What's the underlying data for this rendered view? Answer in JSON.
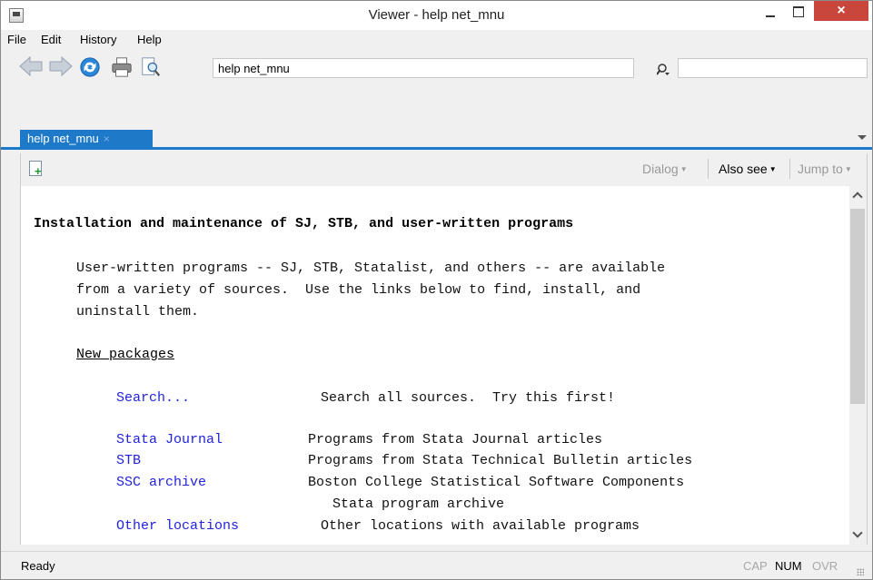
{
  "window": {
    "title": "Viewer - help net_mnu",
    "close_glyph": "×"
  },
  "menu": {
    "items": [
      "File",
      "Edit",
      "History",
      "Help"
    ]
  },
  "toolbar": {
    "address_value": "help net_mnu",
    "search_value": ""
  },
  "tabs": [
    {
      "label": "help net_mnu",
      "close_glyph": "×"
    }
  ],
  "helpbar": {
    "dialog": "Dialog",
    "also_see": "Also see",
    "jump_to": "Jump to"
  },
  "content": {
    "heading": "Installation and maintenance of SJ, STB, and user-written programs",
    "intro_lines": [
      "User-written programs -- SJ, STB, Statalist, and others -- are available",
      "from a variety of sources.  Use the links below to find, install, and",
      "uninstall them."
    ],
    "section_title": "New packages",
    "entries": [
      {
        "link": "Search...",
        "desc": "Search all sources.  Try this first!"
      },
      {
        "link": "Stata Journal",
        "desc": "Programs from Stata Journal articles"
      },
      {
        "link": "STB",
        "desc": "Programs from Stata Technical Bulletin articles"
      },
      {
        "link": "SSC archive",
        "desc": "Boston College Statistical Software Components"
      },
      {
        "link": "",
        "desc": "   Stata program archive"
      },
      {
        "link": "Other locations",
        "desc": "Other locations with available programs"
      }
    ]
  },
  "status": {
    "text": "Ready",
    "cap": "CAP",
    "num": "NUM",
    "ovr": "OVR"
  },
  "colors": {
    "accent": "#1e7ac9",
    "link": "#2222dd",
    "close": "#c9463d"
  }
}
